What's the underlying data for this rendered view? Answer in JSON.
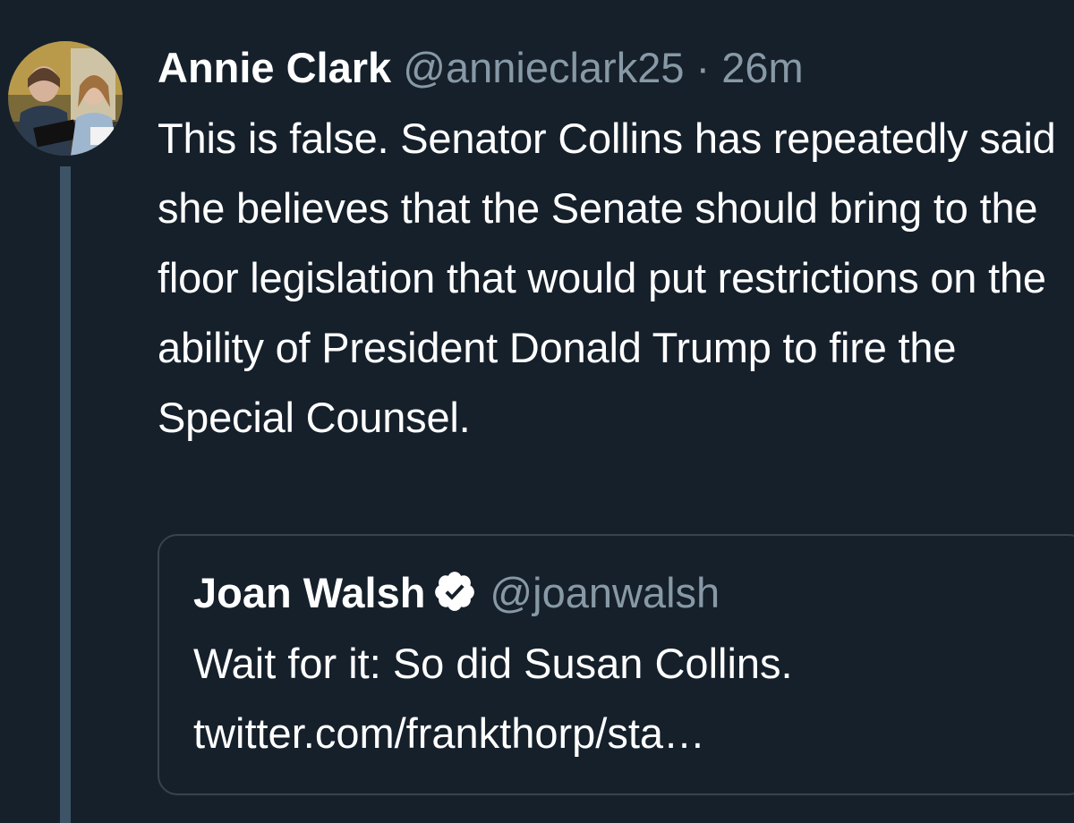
{
  "tweet": {
    "author_name": "Annie Clark",
    "author_handle": "@annieclark25",
    "separator": " · ",
    "timestamp": "26m",
    "text": "This is false. Senator Collins has repeatedly said she believes that the Senate should bring to the floor legislation that would put restrictions on the ability of President Donald Trump to fire the Special Counsel."
  },
  "quoted_tweet": {
    "author_name": "Joan Walsh",
    "author_handle": "@joanwalsh",
    "verified_icon": "verified-badge-icon",
    "text_line": "Wait for it: So did Susan Collins.",
    "link": "twitter.com/frankthorp/sta…"
  },
  "colors": {
    "background": "#15202b",
    "text_primary": "#ffffff",
    "text_secondary": "#8899a6",
    "border": "#38444d",
    "thread_line": "#3d5466"
  }
}
